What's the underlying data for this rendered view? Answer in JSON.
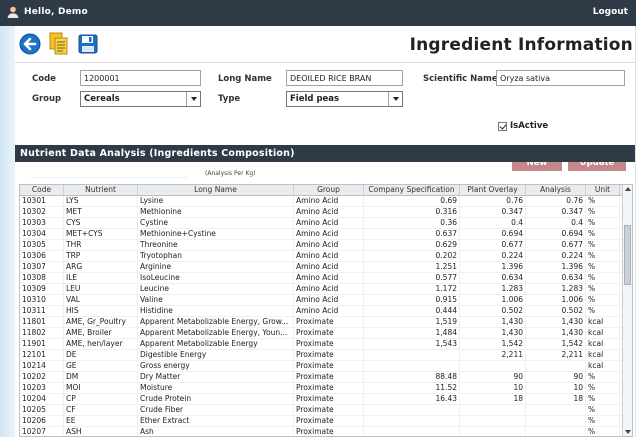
{
  "header": {
    "greeting": "Hello, Demo",
    "logout": "Logout"
  },
  "toolbar": {
    "back_icon": "back-arrow-icon",
    "copy_icon": "copy-documents-icon",
    "save_icon": "floppy-disk-icon"
  },
  "page_title": "Ingredient Information",
  "form": {
    "code_label": "Code",
    "code_value": "1200001",
    "long_name_label": "Long Name",
    "long_name_value": "DEOILED RICE BRAN",
    "scientific_name_label": "Scientific Name",
    "scientific_name_value": "Oryza sativa",
    "group_label": "Group",
    "group_value": "Cereals",
    "type_label": "Type",
    "type_value": "Field peas",
    "is_active_label": "IsActive",
    "is_active": true,
    "new_button": "New",
    "update_button": "Update"
  },
  "section_title": "Nutrient Data Analysis (Ingredients Composition)",
  "analysis_per": "(Analysis Per Kg)",
  "grid": {
    "columns": [
      "Code",
      "Nutrient",
      "Long Name",
      "Group",
      "Company Specification",
      "Plant Overlay",
      "Analysis",
      "Unit"
    ],
    "rows": [
      [
        "10301",
        "LYS",
        "Lysine",
        "Amino Acid",
        "0.69",
        "0.76",
        "0.76",
        "%"
      ],
      [
        "10302",
        "MET",
        "Methionine",
        "Amino Acid",
        "0.316",
        "0.347",
        "0.347",
        "%"
      ],
      [
        "10303",
        "CYS",
        "Cystine",
        "Amino Acid",
        "0.36",
        "0.4",
        "0.4",
        "%"
      ],
      [
        "10304",
        "MET+CYS",
        "Methionine+Cystine",
        "Amino Acid",
        "0.637",
        "0.694",
        "0.694",
        "%"
      ],
      [
        "10305",
        "THR",
        "Threonine",
        "Amino Acid",
        "0.629",
        "0.677",
        "0.677",
        "%"
      ],
      [
        "10306",
        "TRP",
        "Tryotophan",
        "Amino Acid",
        "0.202",
        "0.224",
        "0.224",
        "%"
      ],
      [
        "10307",
        "ARG",
        "Arginine",
        "Amino Acid",
        "1.251",
        "1.396",
        "1.396",
        "%"
      ],
      [
        "10308",
        "ILE",
        "IsoLeucine",
        "Amino Acid",
        "0.577",
        "0.634",
        "0.634",
        "%"
      ],
      [
        "10309",
        "LEU",
        "Leucine",
        "Amino Acid",
        "1.172",
        "1.283",
        "1.283",
        "%"
      ],
      [
        "10310",
        "VAL",
        "Valine",
        "Amino Acid",
        "0.915",
        "1.006",
        "1.006",
        "%"
      ],
      [
        "10311",
        "HIS",
        "Histidine",
        "Amino Acid",
        "0.444",
        "0.502",
        "0.502",
        "%"
      ],
      [
        "11801",
        "AME, Gr_Poultry",
        "Apparent Metabolizable Energy, Grow...",
        "Proximate",
        "1,519",
        "1,430",
        "1,430",
        "kcal"
      ],
      [
        "11802",
        "AME, Broiler",
        "Apparent Metabolizable Energy, Youn...",
        "Proximate",
        "1,484",
        "1,430",
        "1,430",
        "kcal"
      ],
      [
        "11901",
        "AME, hen/layer",
        "Apparent Metabolizable Energy",
        "Proximate",
        "1,543",
        "1,542",
        "1,542",
        "kcal"
      ],
      [
        "12101",
        "DE",
        "Digestible Energy",
        "Proximate",
        "",
        "2,211",
        "2,211",
        "kcal"
      ],
      [
        "10214",
        "GE",
        "Gross energy",
        "Proximate",
        "",
        "",
        "",
        "kcal"
      ],
      [
        "10202",
        "DM",
        "Dry Matter",
        "Proximate",
        "88.48",
        "90",
        "90",
        "%"
      ],
      [
        "10203",
        "MOI",
        "Moisture",
        "Proximate",
        "11.52",
        "10",
        "10",
        "%"
      ],
      [
        "10204",
        "CP",
        "Crude Protein",
        "Proximate",
        "16.43",
        "18",
        "18",
        "%"
      ],
      [
        "10205",
        "CF",
        "Crude Fiber",
        "Proximate",
        "",
        "",
        "",
        "%"
      ],
      [
        "10206",
        "EE",
        "Ether Extract",
        "Proximate",
        "",
        "",
        "",
        "%"
      ],
      [
        "10207",
        "ASH",
        "Ash",
        "Proximate",
        "",
        "",
        "",
        "%"
      ]
    ]
  }
}
